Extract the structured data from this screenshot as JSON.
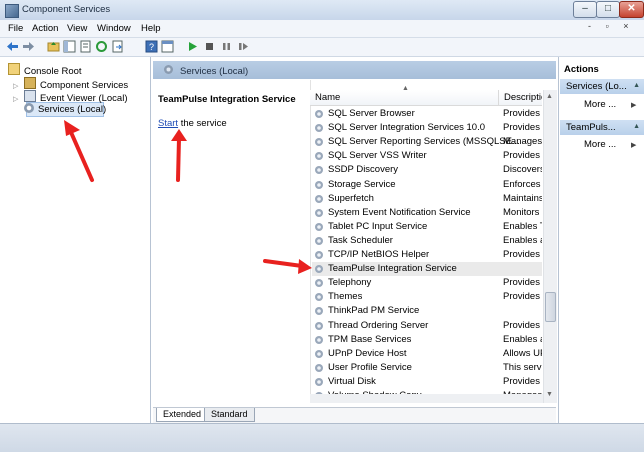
{
  "window": {
    "title": "Component Services",
    "mdi_controls": "- ▫ ×"
  },
  "menu": [
    "File",
    "Action",
    "View",
    "Window",
    "Help"
  ],
  "tree": {
    "items": [
      {
        "label": "Console Root"
      },
      {
        "label": "Component Services"
      },
      {
        "label": "Event Viewer (Local)"
      },
      {
        "label": "Services (Local)"
      }
    ]
  },
  "center": {
    "header": "Services (Local)",
    "service_title": "TeamPulse Integration Service",
    "action_link": "Start",
    "action_rest": " the service"
  },
  "list": {
    "columns": [
      "Name",
      "Descriptio"
    ],
    "rows": [
      {
        "name": "SQL Server Browser",
        "desc": "Provides S"
      },
      {
        "name": "SQL Server Integration Services 10.0",
        "desc": "Provides n"
      },
      {
        "name": "SQL Server Reporting Services (MSSQLSE...",
        "desc": "Manages, "
      },
      {
        "name": "SQL Server VSS Writer",
        "desc": "Provides th"
      },
      {
        "name": "SSDP Discovery",
        "desc": "Discovers"
      },
      {
        "name": "Storage Service",
        "desc": "Enforces g"
      },
      {
        "name": "Superfetch",
        "desc": "Maintains"
      },
      {
        "name": "System Event Notification Service",
        "desc": "Monitors s"
      },
      {
        "name": "Tablet PC Input Service",
        "desc": "Enables Ta"
      },
      {
        "name": "Task Scheduler",
        "desc": "Enables a"
      },
      {
        "name": "TCP/IP NetBIOS Helper",
        "desc": "Provides s"
      },
      {
        "name": "TeamPulse Integration Service",
        "desc": ""
      },
      {
        "name": "Telephony",
        "desc": "Provides T"
      },
      {
        "name": "Themes",
        "desc": "Provides u"
      },
      {
        "name": "ThinkPad PM Service",
        "desc": ""
      },
      {
        "name": "Thread Ordering Server",
        "desc": "Provides o"
      },
      {
        "name": "TPM Base Services",
        "desc": "Enables ac"
      },
      {
        "name": "UPnP Device Host",
        "desc": "Allows UP"
      },
      {
        "name": "User Profile Service",
        "desc": "This servic"
      },
      {
        "name": "Virtual Disk",
        "desc": "Provides m"
      },
      {
        "name": "Volume Shadow Copy",
        "desc": "Manages a"
      }
    ]
  },
  "tabs": [
    "Extended",
    "Standard"
  ],
  "actions": {
    "title": "Actions",
    "groups": [
      {
        "header": "Services (Lo...",
        "more": "More ..."
      },
      {
        "header": "TeamPuls...",
        "more": "More ..."
      }
    ]
  },
  "colors": {
    "annotation_arrow": "#e8211f",
    "selection": "#dbe8f7",
    "header_band": "#b9cde4"
  }
}
